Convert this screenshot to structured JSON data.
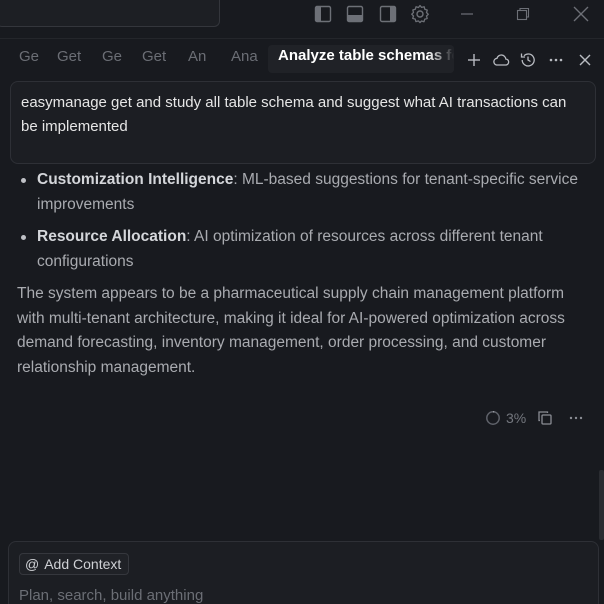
{
  "tabs": [
    {
      "label": "Ge"
    },
    {
      "label": "Get"
    },
    {
      "label": "Ge"
    },
    {
      "label": "Get"
    },
    {
      "label": "An"
    },
    {
      "label": "Ana"
    },
    {
      "label": "Analyze table schemas fo",
      "active": true
    }
  ],
  "titlebar_icons": [
    "toggle-left-panel-icon",
    "toggle-bottom-panel-icon",
    "toggle-right-panel-icon",
    "settings-gear-icon",
    "minimize-icon",
    "restore-icon",
    "close-window-icon"
  ],
  "tab_actions": [
    "new-chat-plus-icon",
    "cloud-icon",
    "history-icon",
    "more-icon",
    "close-panel-icon"
  ],
  "user_message": "easymanage get and study all table schema and suggest what AI transactions can be implemented",
  "response": {
    "bullets": [
      {
        "title": "Customization Intelligence",
        "text": ": ML-based suggestions for tenant-specific service improvements"
      },
      {
        "title": "Resource Allocation",
        "text": ": AI optimization of resources across different tenant configurations"
      }
    ],
    "paragraph": "The system appears to be a pharmaceutical supply chain management platform with multi-tenant architecture, making it ideal for AI-powered optimization across demand forecasting, inventory management, order processing, and customer relationship management."
  },
  "message_footer": {
    "context_usage": "3%",
    "icons": [
      "context-progress-icon",
      "copy-icon",
      "more-icon"
    ]
  },
  "composer": {
    "add_context_label": "Add Context",
    "placeholder": "Plan, search, build anything"
  },
  "colors": {
    "background": "#181a1f",
    "surface": "#1c1e23",
    "text_primary": "#e6e6e6",
    "text_secondary": "#a9abb0",
    "muted": "#6b6e75"
  }
}
